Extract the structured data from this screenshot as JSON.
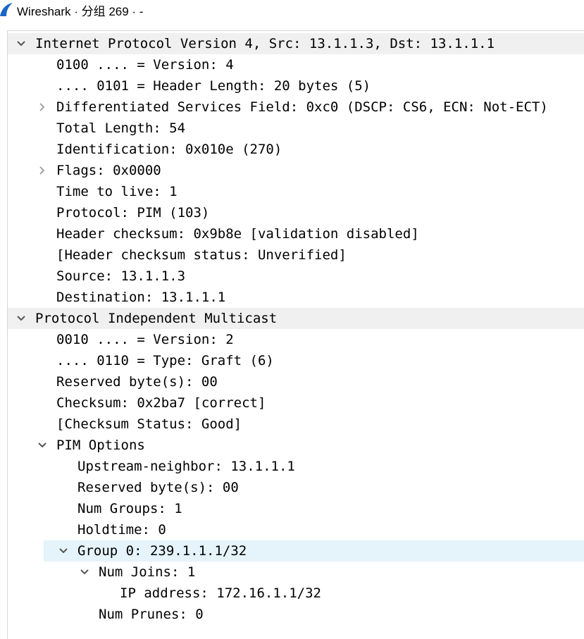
{
  "window": {
    "title": "Wireshark · 分组 269 · -",
    "icon": "wireshark-fin-icon",
    "accent": "#1a66c7"
  },
  "tree": {
    "rows": [
      {
        "text": "Internet Protocol Version 4, Src: 13.1.1.3, Dst: 13.1.1.1",
        "state": "expanded"
      },
      {
        "text": "0100 .... = Version: 4"
      },
      {
        "text": ".... 0101 = Header Length: 20 bytes (5)"
      },
      {
        "text": "Differentiated Services Field: 0xc0 (DSCP: CS6, ECN: Not-ECT)",
        "state": "collapsed"
      },
      {
        "text": "Total Length: 54"
      },
      {
        "text": "Identification: 0x010e (270)"
      },
      {
        "text": "Flags: 0x0000",
        "state": "collapsed"
      },
      {
        "text": "Time to live: 1"
      },
      {
        "text": "Protocol: PIM (103)"
      },
      {
        "text": "Header checksum: 0x9b8e [validation disabled]"
      },
      {
        "text": "[Header checksum status: Unverified]"
      },
      {
        "text": "Source: 13.1.1.3"
      },
      {
        "text": "Destination: 13.1.1.1"
      },
      {
        "text": "Protocol Independent Multicast",
        "state": "expanded"
      },
      {
        "text": "0010 .... = Version: 2"
      },
      {
        "text": ".... 0110 = Type: Graft (6)"
      },
      {
        "text": "Reserved byte(s): 00"
      },
      {
        "text": "Checksum: 0x2ba7 [correct]"
      },
      {
        "text": "[Checksum Status: Good]"
      },
      {
        "text": "PIM Options",
        "state": "expanded"
      },
      {
        "text": "Upstream-neighbor: 13.1.1.1"
      },
      {
        "text": "Reserved byte(s): 00"
      },
      {
        "text": "Num Groups: 1"
      },
      {
        "text": "Holdtime: 0"
      },
      {
        "text": "Group 0: 239.1.1.1/32",
        "state": "expanded",
        "selected": true
      },
      {
        "text": "Num Joins: 1",
        "state": "expanded"
      },
      {
        "text": "IP address: 172.16.1.1/32"
      },
      {
        "text": "Num Prunes: 0"
      }
    ]
  },
  "colors": {
    "header_row_bg": "#f0f0f0",
    "selected_row_bg": "#e5f3fb",
    "toggle_color": "#555555"
  }
}
